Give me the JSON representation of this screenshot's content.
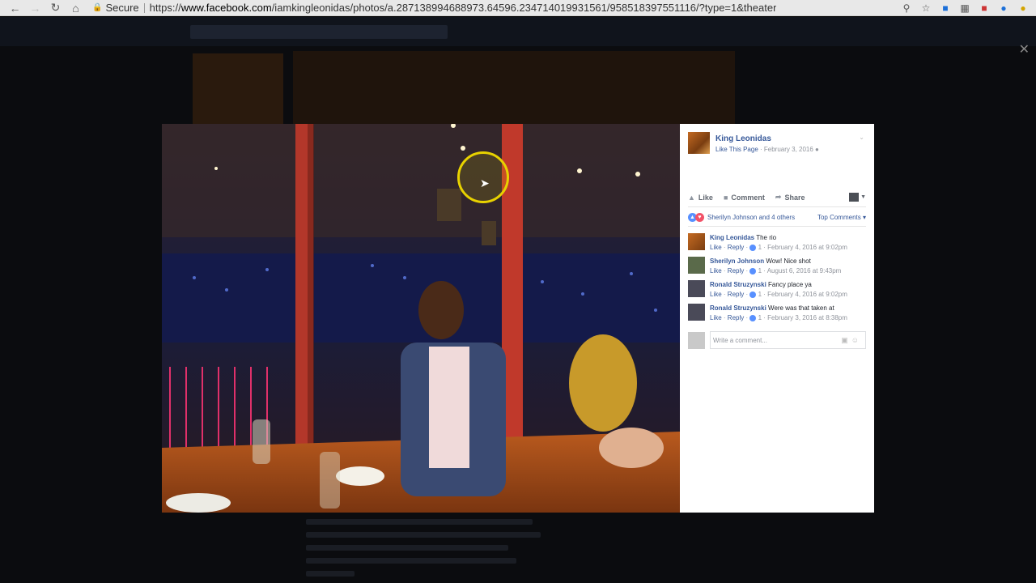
{
  "browser": {
    "secure_label": "Secure",
    "url_scheme": "https://",
    "url_host": "www.facebook.com",
    "url_path": "/iamkingleonidas/photos/a.287138994688973.64596.234714019931561/958518397551116/?type=1&theater"
  },
  "post": {
    "page_name": "King Leonidas",
    "like_page": "Like This Page",
    "date": "February 3, 2016",
    "separator": " · "
  },
  "actions": {
    "like": "Like",
    "comment": "Comment",
    "share": "Share"
  },
  "reactions": {
    "summary": "Sherilyn Johnson and 4 others",
    "sort": "Top Comments"
  },
  "comments": [
    {
      "author": "King Leonidas",
      "text": "The rio",
      "like": "Like",
      "reply": "Reply",
      "count": "1",
      "time": "February 4, 2016 at 9:02pm"
    },
    {
      "author": "Sherilyn Johnson",
      "text": "Wow! Nice shot",
      "like": "Like",
      "reply": "Reply",
      "count": "1",
      "time": "August 6, 2016 at 9:43pm"
    },
    {
      "author": "Ronald Struzynski",
      "text": "Fancy place ya",
      "like": "Like",
      "reply": "Reply",
      "count": "1",
      "time": "February 4, 2016 at 9:02pm"
    },
    {
      "author": "Ronald Struzynski",
      "text": "Were was that taken at",
      "like": "Like",
      "reply": "Reply",
      "count": "1",
      "time": "February 3, 2016 at 8:38pm"
    }
  ],
  "composer": {
    "placeholder": "Write a comment..."
  },
  "colors": {
    "link": "#365899",
    "cursor_ring": "#e8d200"
  }
}
